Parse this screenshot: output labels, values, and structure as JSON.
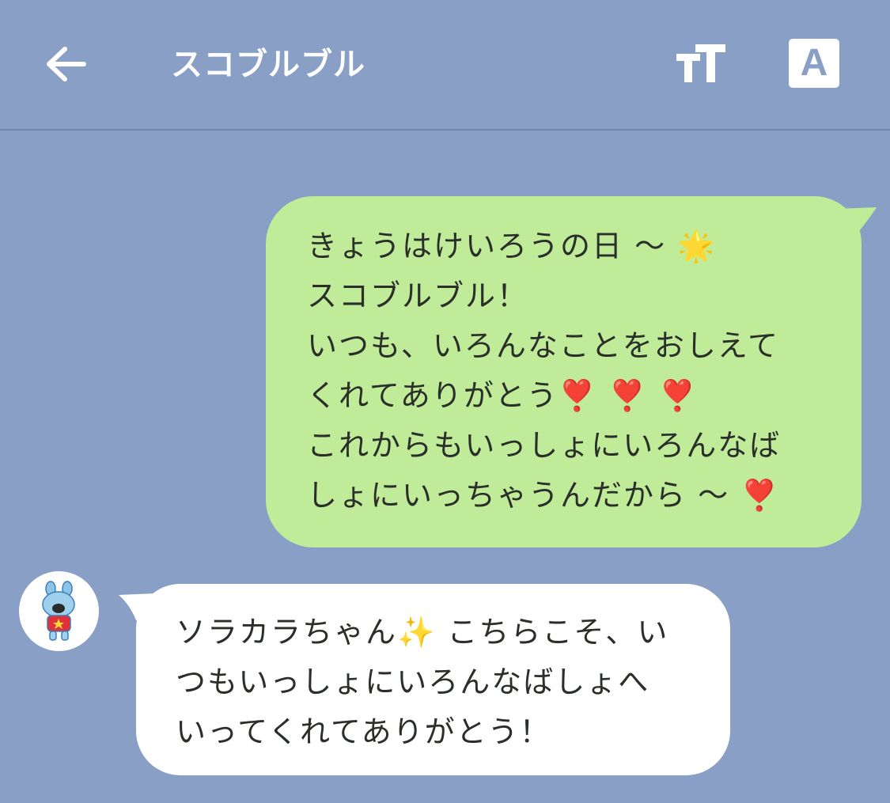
{
  "header": {
    "title": "スコブルブル",
    "back_icon": "arrow-left-icon",
    "font_size_icon": "text-size-icon",
    "translate_label": "A",
    "translate_icon": "translate-icon"
  },
  "colors": {
    "background": "#8a9fc6",
    "outgoing_bubble": "#c0eb99",
    "incoming_bubble": "#ffffff",
    "text": "#2a2f2a"
  },
  "messages": [
    {
      "direction": "outgoing",
      "text": "きょうはけいろうの日 〜 🌟\nスコブルブル！\nいつも、いろんなことをおしえて\nくれてありがとう❣️ ❣️ ❣️\nこれからもいっしょにいろんなば\nしょにいっちゃうんだから 〜 ❣️"
    },
    {
      "direction": "incoming",
      "avatar_icon": "bulldog-avatar-icon",
      "text": "ソラカラちゃん✨ こちらこそ、い\nつもいっしょにいろんなばしょへ\nいってくれてありがとう！"
    }
  ]
}
